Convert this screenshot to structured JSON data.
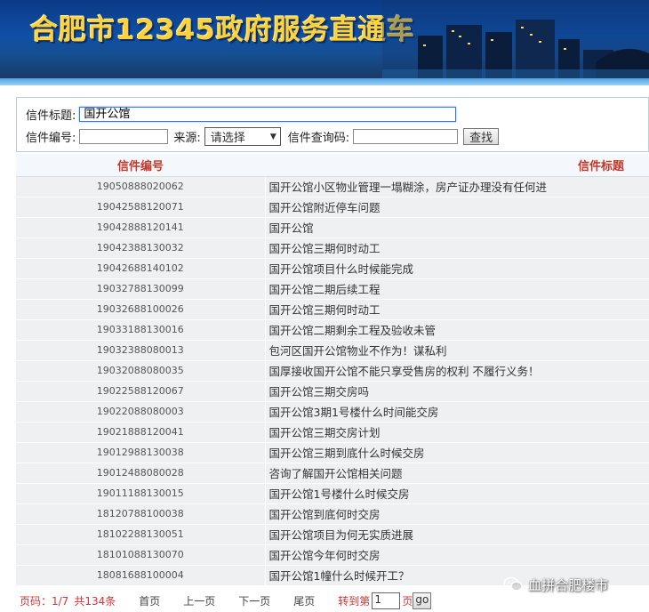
{
  "banner": {
    "title": "合肥市12345政府服务直通车"
  },
  "search": {
    "title_label": "信件标题:",
    "title_value": "国开公馆",
    "number_label": "信件编号:",
    "number_value": "",
    "source_label": "来源:",
    "source_selected": "请选择",
    "code_label": "信件查询码:",
    "code_value": "",
    "search_button": "查找"
  },
  "table": {
    "headers": [
      "信件编号",
      "信件标题"
    ],
    "rows": [
      {
        "id": "19050888020062",
        "title": "国开公馆小区物业管理一塌糊涂，房产证办理没有任何进"
      },
      {
        "id": "19042588120071",
        "title": "国开公馆附近停车问题"
      },
      {
        "id": "19042888120141",
        "title": "国开公馆"
      },
      {
        "id": "19042388130032",
        "title": "国开公馆三期何时动工"
      },
      {
        "id": "19042688140102",
        "title": "国开公馆项目什么时候能完成"
      },
      {
        "id": "19032788130099",
        "title": "国开公馆二期后续工程"
      },
      {
        "id": "19032688100026",
        "title": "国开公馆三期何时动工"
      },
      {
        "id": "19033188130016",
        "title": "国开公馆二期剩余工程及验收未管"
      },
      {
        "id": "19032388080013",
        "title": "包河区国开公馆物业不作为！谋私利"
      },
      {
        "id": "19032088080035",
        "title": "国厚接收国开公馆不能只享受售房的权利 不履行义务！"
      },
      {
        "id": "19022588120067",
        "title": "国开公馆三期交房吗"
      },
      {
        "id": "19022088080003",
        "title": "国开公馆3期1号楼什么时间能交房"
      },
      {
        "id": "19021888120041",
        "title": "国开公馆三期交房计划"
      },
      {
        "id": "19012988130038",
        "title": "国开公馆三期到底什么时候交房"
      },
      {
        "id": "19012488080028",
        "title": "咨询了解国开公馆相关问题"
      },
      {
        "id": "19011188130015",
        "title": "国开公馆1号楼什么时候交房"
      },
      {
        "id": "18120788100038",
        "title": "国开公馆到底何时交房"
      },
      {
        "id": "18102288130051",
        "title": "国开公馆项目为何无实质进展"
      },
      {
        "id": "18101088130070",
        "title": "国开公馆今年何时交房"
      },
      {
        "id": "18081688100004",
        "title": "国开公馆1幢什么时候开工？"
      }
    ]
  },
  "pager": {
    "page_info": "页码：1/7",
    "total": "共134条",
    "first": "首页",
    "prev": "上一页",
    "next": "下一页",
    "last": "尾页",
    "goto_prefix": "转到第",
    "goto_value": "1",
    "goto_suffix": "页",
    "go": "go"
  },
  "watermark": {
    "text": "血拼合肥楼市"
  }
}
